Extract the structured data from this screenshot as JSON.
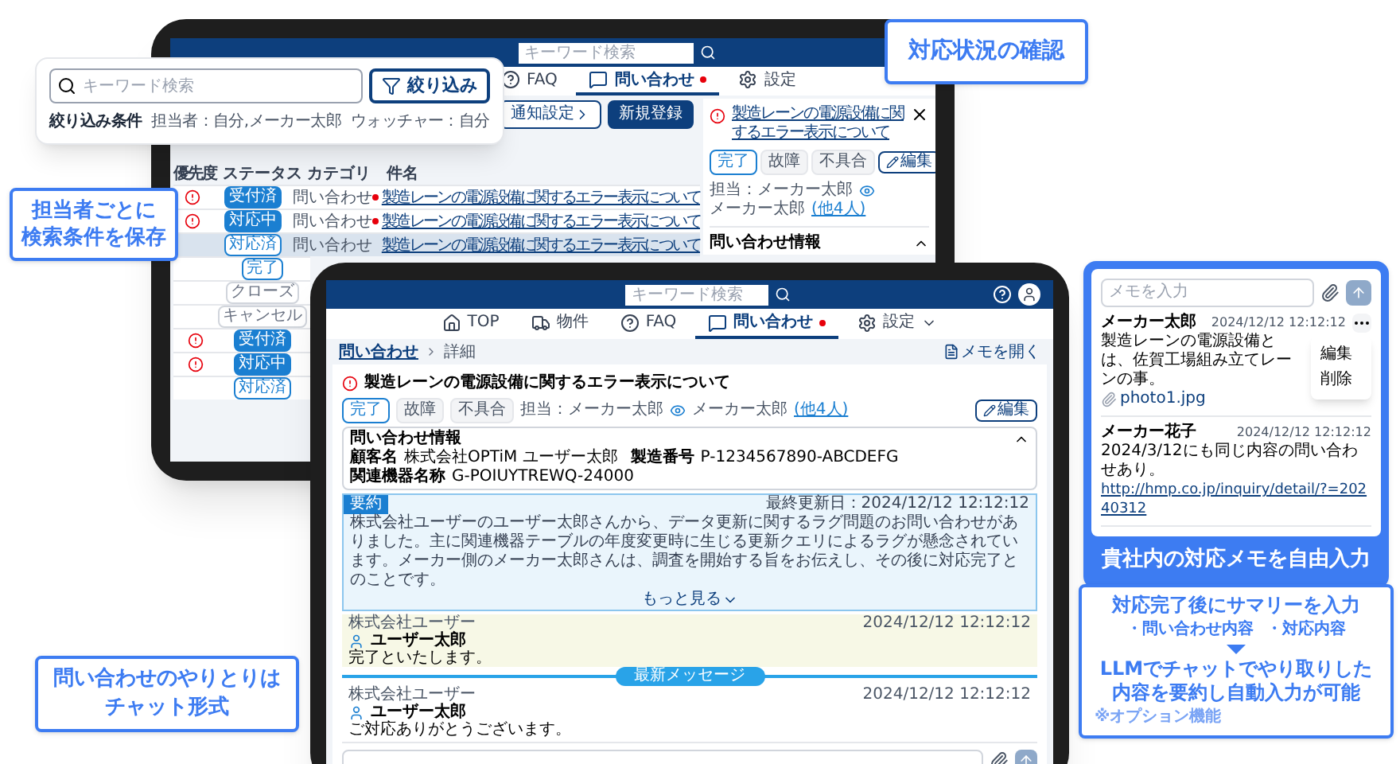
{
  "back_screen": {
    "search": {
      "placeholder": "キーワード検索"
    },
    "nav": [
      {
        "label": "FAQ",
        "kind": "faq",
        "selected": false,
        "unread": false
      },
      {
        "label": "問い合わせ",
        "kind": "inquiry",
        "selected": true,
        "unread": true
      },
      {
        "label": "設定",
        "kind": "settings",
        "selected": false,
        "unread": false
      }
    ],
    "actions": [
      {
        "label": "通知設定",
        "kind": "outline"
      },
      {
        "label": "新規登録",
        "kind": "primary"
      }
    ],
    "columns": [
      "優先度",
      "ステータス",
      "カテゴリ",
      "件名"
    ],
    "rows": [
      {
        "urgent": true,
        "status": {
          "label": "受付済",
          "kind": "solid"
        },
        "category": "問い合わせ",
        "subject": "製造レーンの電源設備に関するエラー表示について",
        "unread": true,
        "selected": false
      },
      {
        "urgent": true,
        "status": {
          "label": "対応中",
          "kind": "solid"
        },
        "category": "問い合わせ",
        "subject": "製造レーンの電源設備に関するエラー表示について",
        "unread": true,
        "selected": false
      },
      {
        "urgent": false,
        "status": {
          "label": "対応済",
          "kind": "outline"
        },
        "category": "問い合わせ",
        "subject": "製造レーンの電源設備に関するエラー表示について",
        "unread": false,
        "selected": true
      },
      {
        "urgent": false,
        "status": {
          "label": "完了",
          "kind": "outline"
        },
        "selected": false
      },
      {
        "urgent": false,
        "status": {
          "label": "クローズ",
          "kind": "muted"
        },
        "selected": false
      },
      {
        "urgent": false,
        "status": {
          "label": "キャンセル",
          "kind": "muted"
        },
        "selected": false
      },
      {
        "urgent": true,
        "status": {
          "label": "受付済",
          "kind": "solid"
        },
        "selected": false
      },
      {
        "urgent": true,
        "status": {
          "label": "対応中",
          "kind": "solid"
        },
        "selected": false
      },
      {
        "urgent": false,
        "status": {
          "label": "対応済",
          "kind": "outline"
        },
        "selected": false
      }
    ],
    "detail": {
      "title": "製造レーンの電源設備に関するエラー表示について",
      "tags": [
        {
          "label": "完了",
          "kind": "status"
        },
        {
          "label": "故障",
          "kind": "tag"
        },
        {
          "label": "不具合",
          "kind": "tag"
        }
      ],
      "edit": "編集",
      "assignee": "担当：メーカー太郎",
      "watchers": "メーカー太郎",
      "watchers_more": "(他4人)",
      "section": "問い合わせ情報",
      "expanded": true
    }
  },
  "filter_popup": {
    "search": {
      "placeholder": "キーワード検索"
    },
    "button": "絞り込み",
    "conditions_label": "絞り込み条件",
    "conditions": [
      "担当者：自分,メーカー太郎",
      "ウォッチャー：自分"
    ]
  },
  "front_screen": {
    "search": {
      "placeholder": "キーワード検索"
    },
    "nav": [
      {
        "label": "TOP",
        "kind": "home",
        "selected": false,
        "unread": false,
        "has_menu": false
      },
      {
        "label": "物件",
        "kind": "truck",
        "selected": false,
        "unread": false,
        "has_menu": false
      },
      {
        "label": "FAQ",
        "kind": "faq",
        "selected": false,
        "unread": false,
        "has_menu": false
      },
      {
        "label": "問い合わせ",
        "kind": "inquiry",
        "selected": true,
        "unread": true,
        "has_menu": false
      },
      {
        "label": "設定",
        "kind": "settings",
        "selected": false,
        "unread": false,
        "has_menu": true
      }
    ],
    "breadcrumb": [
      "問い合わせ",
      "詳細"
    ],
    "memo_link": "メモを開く",
    "detail": {
      "title": "製造レーンの電源設備に関するエラー表示について",
      "tags": [
        {
          "label": "完了",
          "kind": "status"
        },
        {
          "label": "故障",
          "kind": "tag"
        },
        {
          "label": "不具合",
          "kind": "tag"
        }
      ],
      "assignee": "担当：メーカー太郎",
      "watchers": "メーカー太郎",
      "watchers_more": "(他4人)",
      "edit": "編集",
      "info": {
        "title": "問い合わせ情報",
        "expanded": true,
        "fields": [
          {
            "label": "顧客名",
            "value": "株式会社OPTiM ユーザー太郎"
          },
          {
            "label": "製造番号",
            "value": "P-1234567890-ABCDEFG"
          },
          {
            "label": "関連機器名称",
            "value": "G-POIUYTREWQ-24000"
          }
        ]
      },
      "summary": {
        "label": "要約",
        "updated": "最終更新日：2024/12/12 12:12:12",
        "text": "株式会社ユーザーのユーザー太郎さんから、データ更新に関するラグ問題のお問い合わせがありました。主に関連機器テーブルの年度変更時に生じる更新クエリによるラグが懸念されています。メーカー側のメーカー太郎さんは、調査を開始する旨をお伝えし、その後に対応完了とのことです。",
        "more": "もっと見る"
      }
    },
    "messages": [
      {
        "company": "株式会社ユーザー",
        "user": "ユーザー太郎",
        "time": "2024/12/12 12:12:12",
        "text": "完了といたします。",
        "highlighted": true
      },
      {
        "company": "株式会社ユーザー",
        "user": "ユーザー太郎",
        "time": "2024/12/12 12:12:12",
        "text": "ご対応ありがとうございます。",
        "highlighted": false
      }
    ],
    "divider": "最新メッセージ"
  },
  "memo_panel": {
    "placeholder": "メモを入力",
    "memos": [
      {
        "author": "メーカー太郎",
        "time": "2024/12/12 12:12:12",
        "text": "製造レーンの電源設備とは、佐賀工場組み立てレーンの事。",
        "attachment": "photo1.jpg",
        "menu_open": true
      },
      {
        "author": "メーカー花子",
        "time": "2024/12/12 12:12:12",
        "text": "2024/3/12にも同じ内容の問い合わせあり。",
        "link": "http://hmp.co.jp/inquiry/detail/?=20240312",
        "menu_open": false
      }
    ],
    "menu": [
      "編集",
      "削除"
    ],
    "caption": "貴社内の対応メモを自由入力"
  },
  "callouts": {
    "search": [
      "担当者ごとに",
      "検索条件を保存"
    ],
    "status": "対応状況の確認",
    "chat": [
      "問い合わせのやりとりは",
      "チャット形式"
    ],
    "summary": {
      "title": "対応完了後にサマリーを入力",
      "items": [
        "・問い合わせ内容",
        "・対応内容"
      ],
      "result": [
        "LLMでチャットでやり取りした",
        "内容を要約し自動入力が可能"
      ],
      "note": "※オプション機能"
    }
  }
}
